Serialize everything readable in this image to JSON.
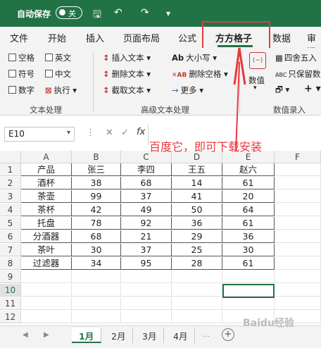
{
  "titlebar": {
    "autosave_label": "自动保存",
    "autosave_state": "关"
  },
  "tabs": [
    "文件",
    "开始",
    "插入",
    "页面布局",
    "公式",
    "方方格子",
    "数据",
    "审阅"
  ],
  "ribbon": {
    "text_group": {
      "checkboxes": [
        "空格",
        "英文",
        "符号",
        "中文",
        "数字"
      ],
      "execute_label": "执行",
      "group_label": "文本处理"
    },
    "adv_group": {
      "insert_text": "插入文本",
      "delete_text": "删除文本",
      "extract_text": "截取文本",
      "case": "大小写",
      "delete_space": "删除空格",
      "more": "更多",
      "group_label": "高级文本处理"
    },
    "num_group": {
      "value_label": "数值",
      "round": "四舍五入",
      "keep_value": "只保留数值",
      "group_label": "数值录入"
    }
  },
  "formula_bar": {
    "name_box": "E10",
    "fx": "fx"
  },
  "annotation": {
    "text": "百度它，即可下载安装",
    "color": "#e8383d"
  },
  "spreadsheet": {
    "columns": [
      "A",
      "B",
      "C",
      "D",
      "E",
      "F"
    ],
    "rows": [
      "1",
      "2",
      "3",
      "4",
      "5",
      "6",
      "7",
      "8",
      "9",
      "10",
      "11",
      "12"
    ],
    "selected_row": "10",
    "table": [
      [
        "产品",
        "张三",
        "李四",
        "王五",
        "赵六"
      ],
      [
        "酒杯",
        "38",
        "68",
        "14",
        "61"
      ],
      [
        "茶壶",
        "99",
        "37",
        "41",
        "20"
      ],
      [
        "茶杯",
        "42",
        "49",
        "50",
        "64"
      ],
      [
        "托盘",
        "78",
        "92",
        "36",
        "61"
      ],
      [
        "分酒器",
        "68",
        "21",
        "29",
        "36"
      ],
      [
        "茶叶",
        "30",
        "37",
        "25",
        "30"
      ],
      [
        "过滤器",
        "34",
        "95",
        "28",
        "61"
      ]
    ]
  },
  "sheets": [
    "1月",
    "2月",
    "3月",
    "4月"
  ],
  "watermark": "Baidu经验",
  "accent": "#217346"
}
